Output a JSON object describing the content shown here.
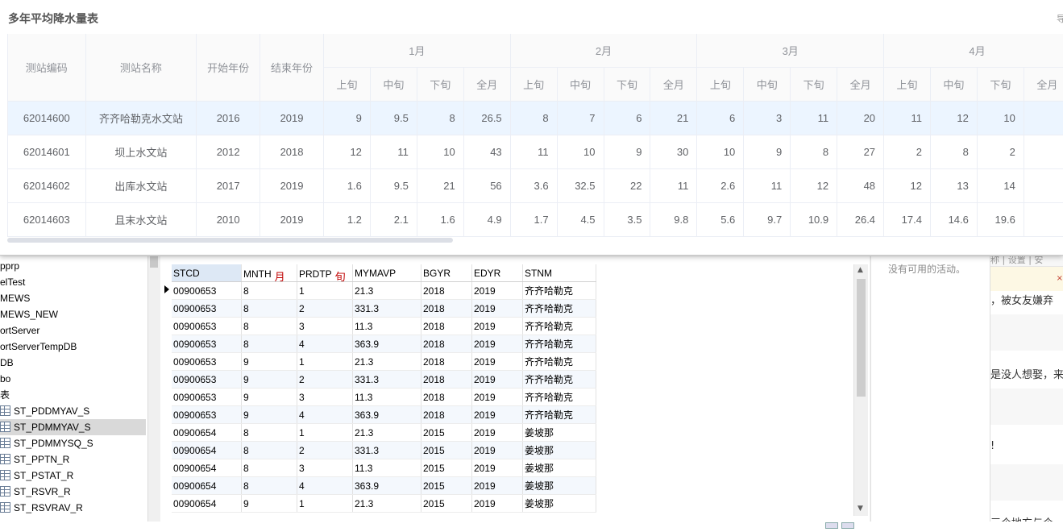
{
  "panel": {
    "title": "多年平均降水量表",
    "corner_text": "导",
    "header_fixed": [
      "测站编码",
      "测站名称",
      "开始年份",
      "结束年份"
    ],
    "months": [
      "1月",
      "2月",
      "3月",
      "4月"
    ],
    "subcols": [
      "上旬",
      "中旬",
      "下旬",
      "全月"
    ],
    "rows": [
      {
        "code": "62014600",
        "name": "齐齐哈勒克水文站",
        "start": "2016",
        "end": "2019",
        "vals": [
          "9",
          "9.5",
          "8",
          "26.5",
          "8",
          "7",
          "6",
          "21",
          "6",
          "3",
          "11",
          "20",
          "11",
          "12",
          "10"
        ]
      },
      {
        "code": "62014601",
        "name": "坝上水文站",
        "start": "2012",
        "end": "2018",
        "vals": [
          "12",
          "11",
          "10",
          "43",
          "11",
          "10",
          "9",
          "30",
          "10",
          "9",
          "8",
          "27",
          "2",
          "8",
          "2"
        ]
      },
      {
        "code": "62014602",
        "name": "出库水文站",
        "start": "2017",
        "end": "2019",
        "vals": [
          "1.6",
          "9.5",
          "21",
          "56",
          "3.6",
          "32.5",
          "22",
          "11",
          "2.6",
          "11",
          "12",
          "48",
          "12",
          "13",
          "14"
        ]
      },
      {
        "code": "62014603",
        "name": "且末水文站",
        "start": "2010",
        "end": "2019",
        "vals": [
          "1.2",
          "2.1",
          "1.6",
          "4.9",
          "1.7",
          "4.5",
          "3.5",
          "9.8",
          "5.6",
          "9.7",
          "10.9",
          "26.4",
          "17.4",
          "14.6",
          "19.6"
        ]
      }
    ]
  },
  "tree": {
    "items": [
      "pprp",
      "elTest",
      "MEWS",
      "MEWS_NEW",
      "ortServer",
      "ortServerTempDB",
      "DB",
      "bo",
      "表"
    ],
    "tables": [
      "ST_PDDMYAV_S",
      "ST_PDMMYAV_S",
      "ST_PDMMYSQ_S",
      "ST_PPTN_R",
      "ST_PSTAT_R",
      "ST_RSVR_R",
      "ST_RSVRAV_R"
    ],
    "selected_table": "ST_PDMMYAV_S"
  },
  "grid": {
    "columns": [
      "STCD",
      "MNTH",
      "PRDTP",
      "MYMAVP",
      "BGYR",
      "EDYR",
      "STNM"
    ],
    "annot_month": "月",
    "annot_period": "旬",
    "rows": [
      [
        "00900653",
        "8",
        "1",
        "21.3",
        "2018",
        "2019",
        "齐齐哈勒克"
      ],
      [
        "00900653",
        "8",
        "2",
        "331.3",
        "2018",
        "2019",
        "齐齐哈勒克"
      ],
      [
        "00900653",
        "8",
        "3",
        "11.3",
        "2018",
        "2019",
        "齐齐哈勒克"
      ],
      [
        "00900653",
        "8",
        "4",
        "363.9",
        "2018",
        "2019",
        "齐齐哈勒克"
      ],
      [
        "00900653",
        "9",
        "1",
        "21.3",
        "2018",
        "2019",
        "齐齐哈勒克"
      ],
      [
        "00900653",
        "9",
        "2",
        "331.3",
        "2018",
        "2019",
        "齐齐哈勒克"
      ],
      [
        "00900653",
        "9",
        "3",
        "11.3",
        "2018",
        "2019",
        "齐齐哈勒克"
      ],
      [
        "00900653",
        "9",
        "4",
        "363.9",
        "2018",
        "2019",
        "齐齐哈勒克"
      ],
      [
        "00900654",
        "8",
        "1",
        "21.3",
        "2015",
        "2019",
        "姜坡那"
      ],
      [
        "00900654",
        "8",
        "2",
        "331.3",
        "2015",
        "2019",
        "姜坡那"
      ],
      [
        "00900654",
        "8",
        "3",
        "11.3",
        "2015",
        "2019",
        "姜坡那"
      ],
      [
        "00900654",
        "8",
        "4",
        "363.9",
        "2015",
        "2019",
        "姜坡那"
      ],
      [
        "00900654",
        "9",
        "1",
        "21.3",
        "2015",
        "2019",
        "姜坡那"
      ]
    ]
  },
  "activity": {
    "message": "没有可用的活动。"
  },
  "browser": {
    "top_bar": "称 | 设置 | 安",
    "line1": "，被女友嫌弃",
    "line2": "是没人想娶，来",
    "line3": "!",
    "line4": "三个地方与个"
  }
}
